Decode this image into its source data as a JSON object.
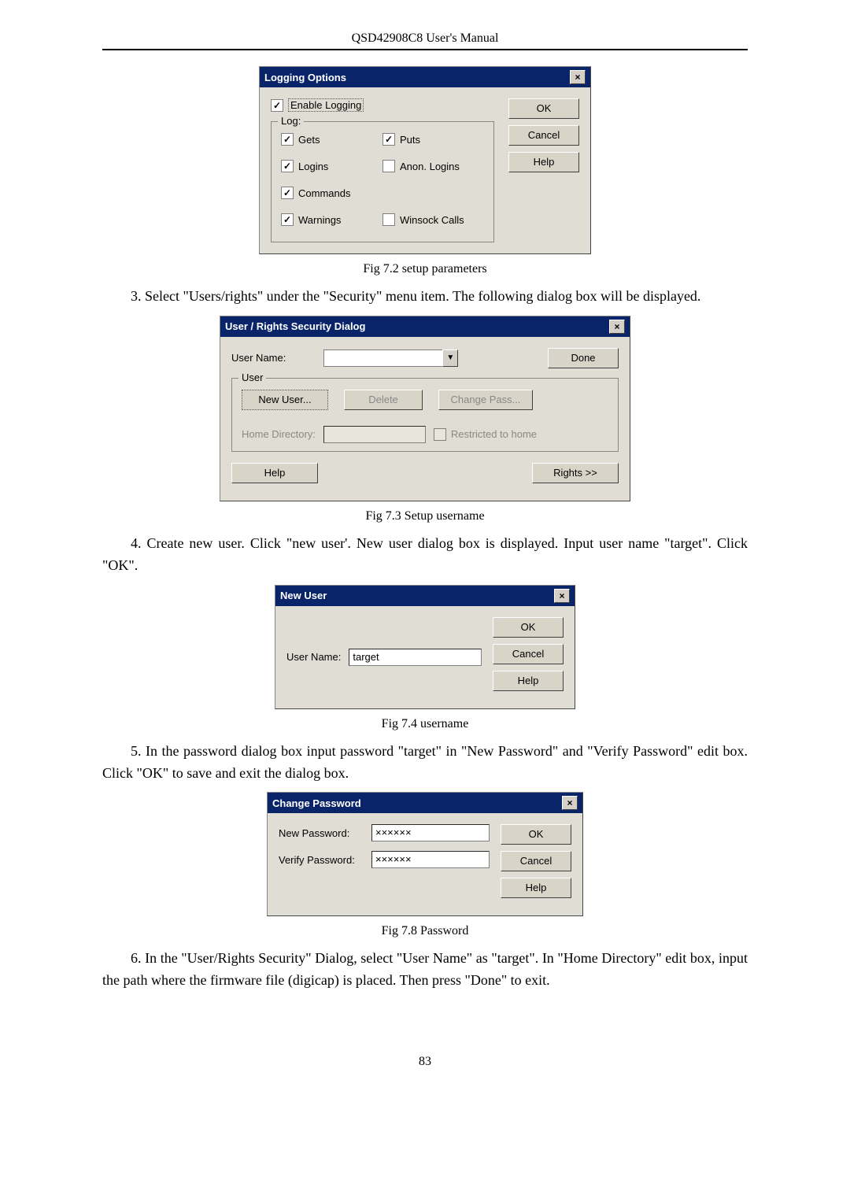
{
  "header": {
    "title": "QSD42908C8 User's Manual"
  },
  "page_number": "83",
  "dlg_logging": {
    "title": "Logging Options",
    "close": "×",
    "enable_logging": "Enable Logging",
    "group_label": "Log:",
    "gets": "Gets",
    "puts": "Puts",
    "logins": "Logins",
    "anon_logins": "Anon. Logins",
    "commands": "Commands",
    "warnings": "Warnings",
    "winsock": "Winsock Calls",
    "btn_ok": "OK",
    "btn_cancel": "Cancel",
    "btn_help": "Help",
    "checked": {
      "enable_logging": true,
      "gets": true,
      "puts": true,
      "logins": true,
      "anon_logins": false,
      "commands": true,
      "warnings": true,
      "winsock": false
    }
  },
  "caption1": "Fig 7.2 setup parameters",
  "para1": "3.    Select \"Users/rights\" under the \"Security\" menu item. The following dialog box will be displayed.",
  "dlg_rights": {
    "title": "User / Rights Security Dialog",
    "close": "×",
    "user_name_label": "User Name:",
    "btn_done": "Done",
    "group_label": "User",
    "btn_newuser": "New User...",
    "btn_delete": "Delete",
    "btn_changepass": "Change Pass...",
    "home_dir_label": "Home Directory:",
    "restricted": "Restricted to home",
    "btn_help": "Help",
    "btn_rights": "Rights >>",
    "restricted_checked": false
  },
  "caption2": "Fig 7.3 Setup username",
  "para2": "4.    Create new user. Click \"new user'. New user dialog box is displayed. Input user name \"target\". Click \"OK\".",
  "dlg_newuser": {
    "title": "New User",
    "close": "×",
    "label": "User Name:",
    "value": "target",
    "btn_ok": "OK",
    "btn_cancel": "Cancel",
    "btn_help": "Help"
  },
  "caption3": "Fig 7.4 username",
  "para3": "5.    In the password dialog box input password \"target\" in \"New Password\" and \"Verify Password\" edit box. Click \"OK\" to save and exit the dialog box.",
  "dlg_changepw": {
    "title": "Change Password",
    "close": "×",
    "new_label": "New Password:",
    "new_value": "××××××",
    "verify_label": "Verify Password:",
    "verify_value": "××××××",
    "btn_ok": "OK",
    "btn_cancel": "Cancel",
    "btn_help": "Help"
  },
  "caption4": "Fig 7.8 Password",
  "para4": "6.    In the \"User/Rights Security\" Dialog, select \"User Name\" as \"target\". In \"Home Directory\" edit box, input the path where the firmware file (digicap) is placed. Then press \"Done\" to exit."
}
